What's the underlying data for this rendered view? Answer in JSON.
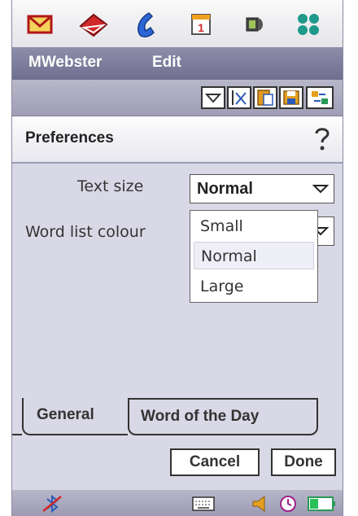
{
  "app_icons": [
    "messages-icon",
    "dictionary-book-icon",
    "phone-icon",
    "calendar-icon",
    "media-player-icon",
    "apps-grid-icon"
  ],
  "calendar_day": "1",
  "menu": {
    "app_name": "MWebster",
    "edit": "Edit"
  },
  "toolbar": {
    "icons": [
      "dropdown-arrow-icon",
      "clear-text-icon",
      "paste-icon",
      "save-icon",
      "options-icon"
    ]
  },
  "title": {
    "text": "Preferences",
    "help_icon": "help-icon"
  },
  "form": {
    "text_size_label": "Text size",
    "text_size_value": "Normal",
    "word_list_label": "Word list colour"
  },
  "dropdown": {
    "options": [
      "Small",
      "Normal",
      "Large"
    ],
    "highlighted": "Normal"
  },
  "tabs": {
    "general": "General",
    "word_of_day": "Word of the Day"
  },
  "buttons": {
    "cancel": "Cancel",
    "done": "Done"
  },
  "status_icons": [
    "bluetooth-off-icon",
    "keyboard-icon",
    "volume-icon",
    "clock-icon",
    "battery-icon"
  ],
  "colors": {
    "accent": "#7a799a",
    "background": "#d9d8e6"
  }
}
